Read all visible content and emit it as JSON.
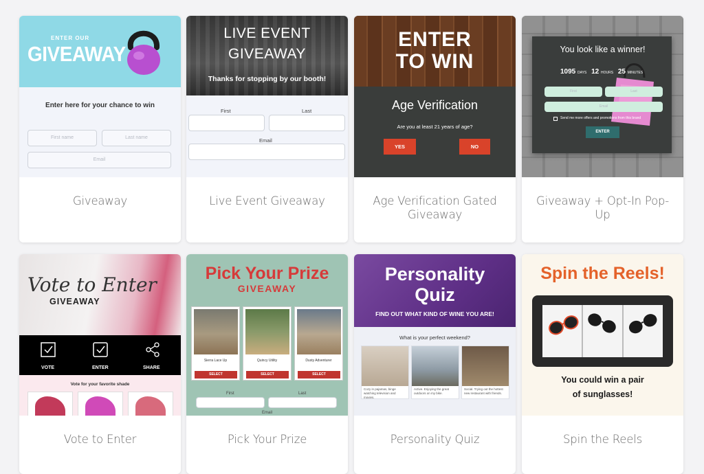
{
  "cards": [
    {
      "title": "Giveaway",
      "thumb": {
        "pre_title": "ENTER OUR",
        "headline": "GIVEAWAY",
        "subhead": "Enter here for your chance to win",
        "first_placeholder": "First name",
        "last_placeholder": "Last name",
        "email_placeholder": "Email"
      }
    },
    {
      "title": "Live Event Giveaway",
      "thumb": {
        "line1": "LIVE EVENT",
        "line2": "GIVEAWAY",
        "tagline": "Thanks for stopping by our booth!",
        "first_label": "First",
        "last_label": "Last",
        "email_label": "Email"
      }
    },
    {
      "title": "Age Verification Gated Giveaway",
      "thumb": {
        "line1": "ENTER",
        "line2": "TO WIN",
        "heading": "Age Verification",
        "question": "Are you at least 21 years of age?",
        "yes": "YES",
        "no": "NO"
      }
    },
    {
      "title": "Giveaway + Opt-In Pop-Up",
      "thumb": {
        "heading": "You look like a winner!",
        "days_value": "1095",
        "days_label": "DAYS",
        "hours_value": "12",
        "hours_label": "HOURS",
        "minutes_value": "25",
        "minutes_label": "MINUTES",
        "first_placeholder": "First",
        "last_placeholder": "Last",
        "email_placeholder": "Email",
        "checkbox_text": "Send me more offers and promotions from this brand",
        "enter": "ENTER"
      }
    },
    {
      "title": "Vote to Enter",
      "thumb": {
        "script_title": "Vote to Enter",
        "subtitle": "GIVEAWAY",
        "step1": "VOTE",
        "step2": "ENTER",
        "step3": "SHARE",
        "vote_prompt": "Vote for your favorite shade"
      }
    },
    {
      "title": "Pick Your Prize",
      "thumb": {
        "headline": "Pick Your Prize",
        "subhead": "GIVEAWAY",
        "products": [
          {
            "name": "Sierra Lace Up",
            "button": "SELECT"
          },
          {
            "name": "Quincy Utility",
            "button": "SELECT"
          },
          {
            "name": "Dusty Adventurer",
            "button": "SELECT"
          }
        ],
        "first_label": "First",
        "last_label": "Last",
        "email_label": "Email"
      }
    },
    {
      "title": "Personality Quiz",
      "thumb": {
        "line1": "Personality",
        "line2": "Quiz",
        "tagline": "FIND OUT WHAT KIND OF WINE YOU ARE!",
        "question": "What is your perfect weekend?",
        "answers": [
          "Cozy in pajamas, binge watching television and movies.",
          "Active. Enjoying the great outdoors on my bike.",
          "Social. Trying out the hottest new restaurant with friends."
        ]
      }
    },
    {
      "title": "Spin the Reels",
      "thumb": {
        "headline": "Spin the Reels!",
        "line1": "You could win a pair",
        "line2": "of sunglasses!"
      }
    }
  ],
  "colors": {
    "giveaway_teal": "#8fd9e6",
    "kettlebell": "#b84fd0",
    "age_red": "#d9432a",
    "popup_dark": "#3a3d3c",
    "enter_teal": "#2f6d6d",
    "vote_pink": "#e05c82",
    "prize_red": "#d63a3a",
    "prize_bg": "#9fc4b4",
    "quiz_purple": "#6a3a8e",
    "reels_orange": "#e4622a"
  }
}
